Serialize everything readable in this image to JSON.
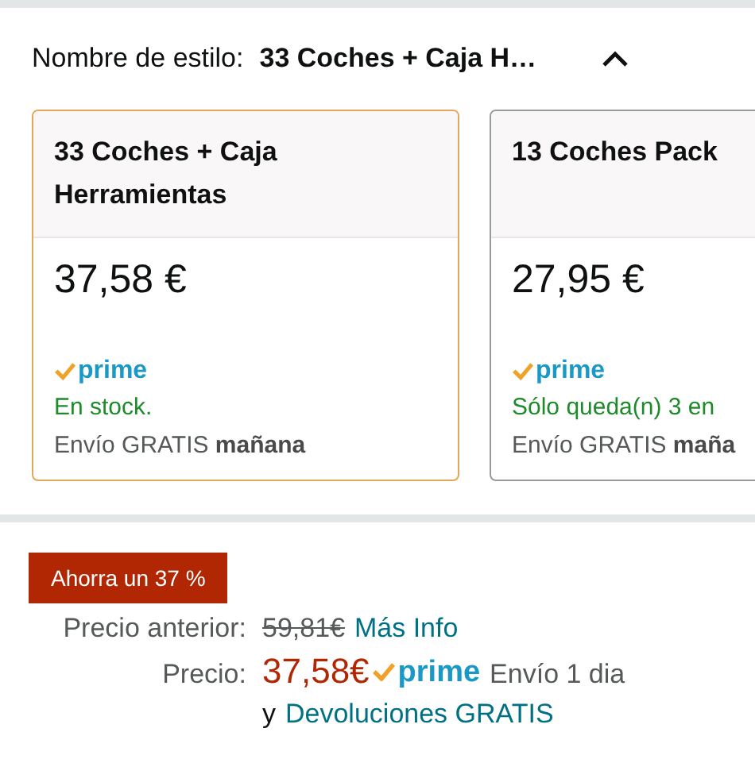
{
  "style_selector": {
    "label": "Nombre de estilo:",
    "value": "33 Coches + Caja H…",
    "expanded": true
  },
  "options": [
    {
      "title": "33 Coches + Caja Herramientas",
      "price": "37,58 €",
      "prime": "prime",
      "availability": "En stock.",
      "delivery": "Envío GRATIS **mañana**",
      "selected": true
    },
    {
      "title": "13 Coches Pack",
      "price": "27,95 €",
      "prime": "prime",
      "availability": "Sólo queda(n) 3 en",
      "delivery": "Envío GRATIS **maña**",
      "selected": false
    }
  ],
  "savings_badge": "Ahorra un 37 %",
  "list_price": {
    "label": "Precio anterior:",
    "value": "59,81€",
    "link": "Más Info"
  },
  "price": {
    "label": "Precio:",
    "value": "37,58€",
    "prime": "prime",
    "shipping": "Envío 1 dia",
    "returns_prefix": "y",
    "returns_link": "Devoluciones GRATIS"
  }
}
